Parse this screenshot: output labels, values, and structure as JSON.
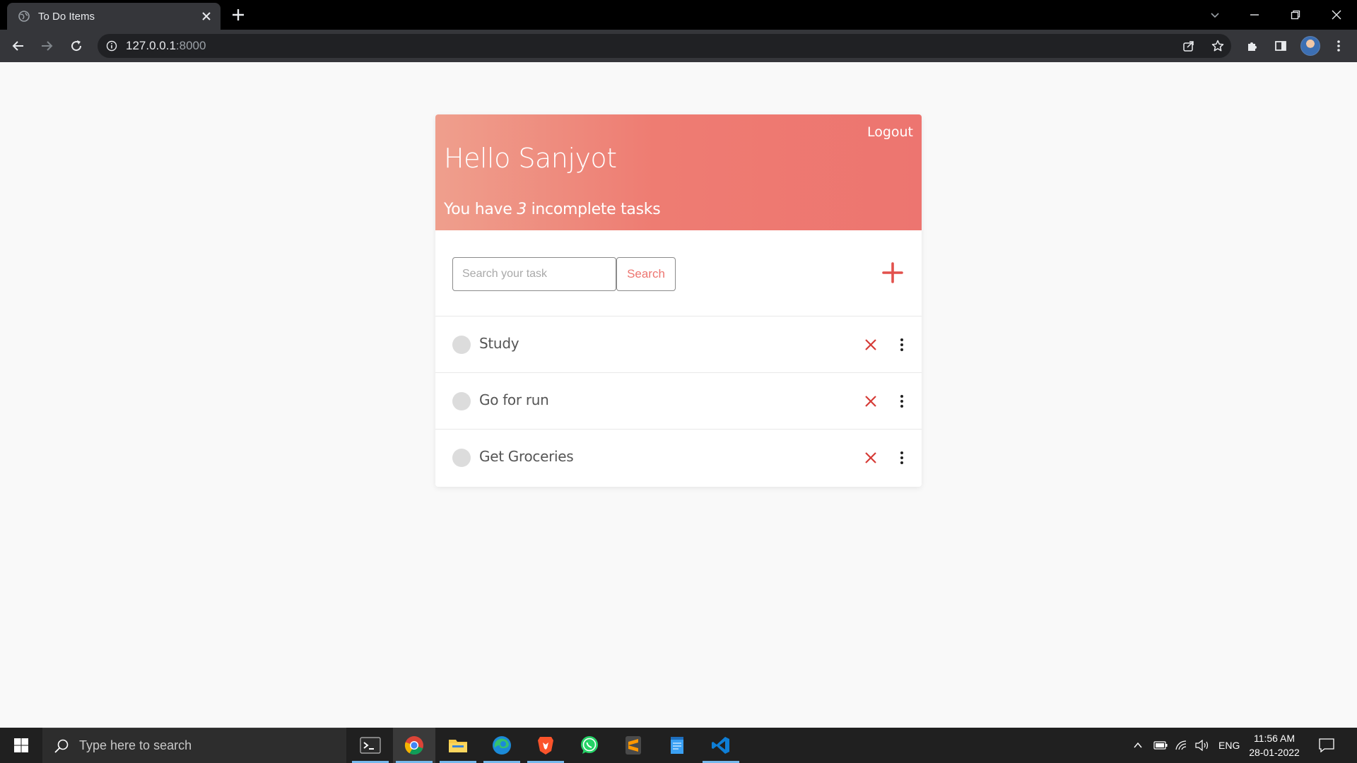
{
  "browser": {
    "tab_title": "To Do Items",
    "url_host": "127.0.0.1",
    "url_port": ":8000"
  },
  "app": {
    "logout_label": "Logout",
    "greeting": "Hello Sanjyot",
    "incomplete_prefix": "You have ",
    "incomplete_count": "3",
    "incomplete_suffix": " incomplete tasks",
    "accent_color": "#ed7570",
    "search": {
      "placeholder": "Search your task",
      "button_label": "Search"
    },
    "tasks": [
      {
        "label": "Study",
        "completed": false
      },
      {
        "label": "Go for run",
        "completed": false
      },
      {
        "label": "Get Groceries",
        "completed": false
      }
    ]
  },
  "taskbar": {
    "search_placeholder": "Type here to search",
    "apps": [
      "terminal-icon",
      "chrome-icon",
      "file-explorer-icon",
      "edge-icon",
      "brave-icon",
      "whatsapp-icon",
      "sublime-text-icon",
      "notepad-icon",
      "vscode-icon"
    ],
    "language": "ENG",
    "time": "11:56 AM",
    "date": "28-01-2022"
  }
}
